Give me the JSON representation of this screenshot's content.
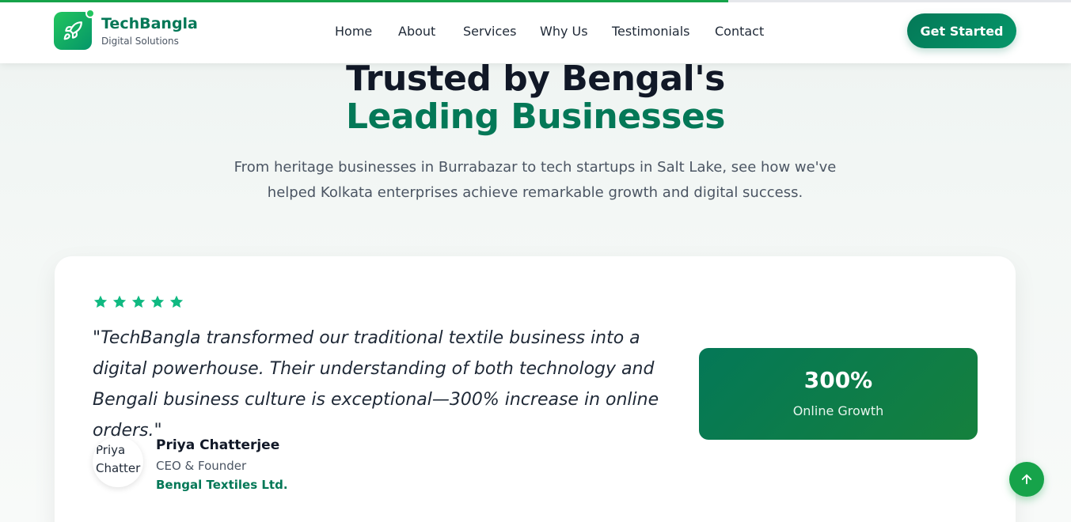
{
  "page": {
    "scroll_progress": 0.68
  },
  "colors": {
    "brand": "#047857",
    "accent": "#16a34a",
    "star": "#10b981"
  },
  "brand": {
    "name": "TechBangla",
    "tagline": "Digital Solutions",
    "logo_icon": "rocket-icon"
  },
  "nav": {
    "items": [
      {
        "label": "Home"
      },
      {
        "label": "About"
      },
      {
        "label": "Services"
      },
      {
        "label": "Why Us"
      },
      {
        "label": "Testimonials"
      },
      {
        "label": "Contact"
      }
    ],
    "cta_label": "Get Started"
  },
  "hero": {
    "title_line1": "Trusted by Bengal's",
    "title_line2": "Leading Businesses",
    "subtitle": "From heritage businesses in Burrabazar to tech startups in Salt Lake, see how we've helped Kolkata enterprises achieve remarkable growth and digital success."
  },
  "testimonial": {
    "rating": 5,
    "quote": "\"TechBangla transformed our traditional textile business into a digital powerhouse. Their understanding of both technology and Bengali business culture is exceptional—300% increase in online orders.\"",
    "avatar_alt": "Priya Chatter",
    "author_name": "Priya Chatterjee",
    "author_role": "CEO & Founder",
    "author_company": "Bengal Textiles Ltd.",
    "stat_value": "300%",
    "stat_label": "Online Growth"
  },
  "scroll_top_icon": "arrow-up-icon"
}
